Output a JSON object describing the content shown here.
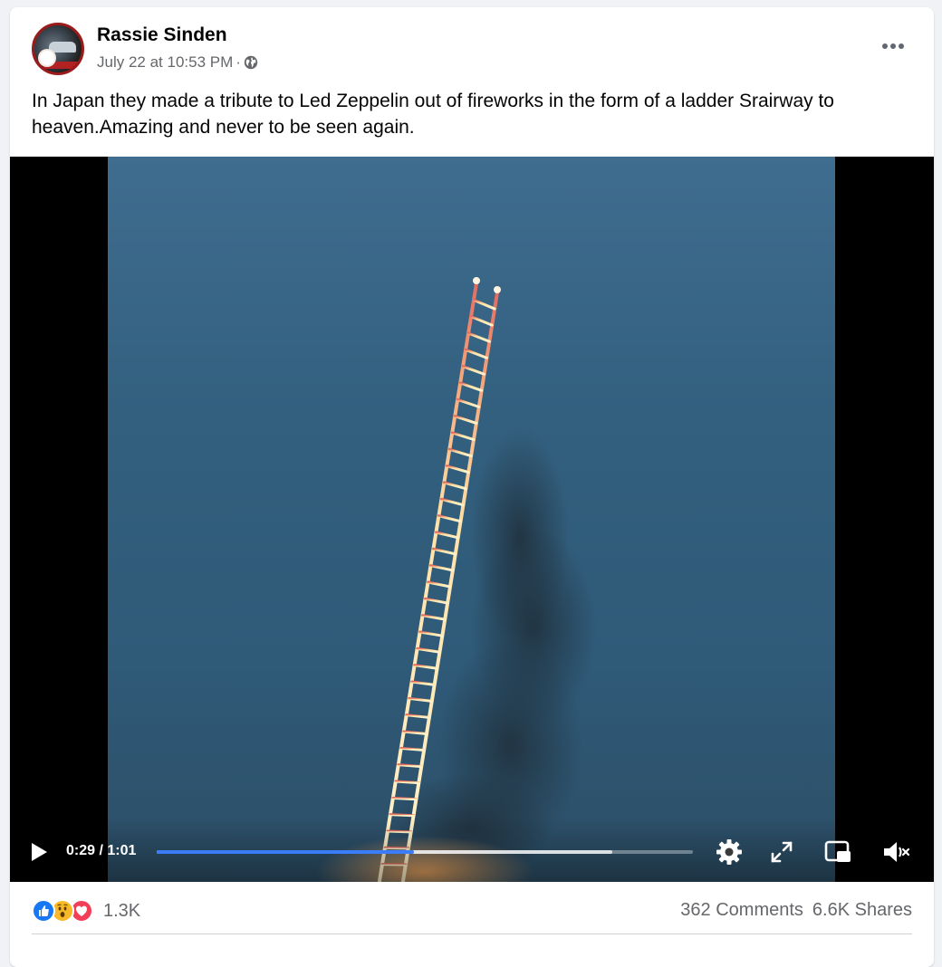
{
  "post": {
    "author": "Rassie Sinden",
    "timestamp": "July 22 at 10:53 PM",
    "separator": "·",
    "privacy_icon": "globe-icon",
    "more_icon": "more-horizontal-icon",
    "text": "In Japan they made a tribute  to Led Zeppelin out of fireworks in the form of a ladder Srairway to heaven.Amazing and never to be seen again."
  },
  "video": {
    "time_current": "0:29",
    "time_separator": " / ",
    "time_total": "1:01",
    "progress_played": 0.48,
    "progress_buffered": 0.85,
    "progress_color": "#3b7df8",
    "controls": [
      "play-icon",
      "settings-icon",
      "fullscreen-icon",
      "picture-in-picture-icon",
      "muted-speaker-icon"
    ]
  },
  "footer": {
    "reactions": [
      "like",
      "wow",
      "love"
    ],
    "reaction_count": "1.3K",
    "comments": "362 Comments",
    "shares": "6.6K Shares"
  },
  "colors": {
    "like": "#1877f2",
    "wow": "#f7b928",
    "love": "#f33e58",
    "secondary_text": "#65676b"
  }
}
